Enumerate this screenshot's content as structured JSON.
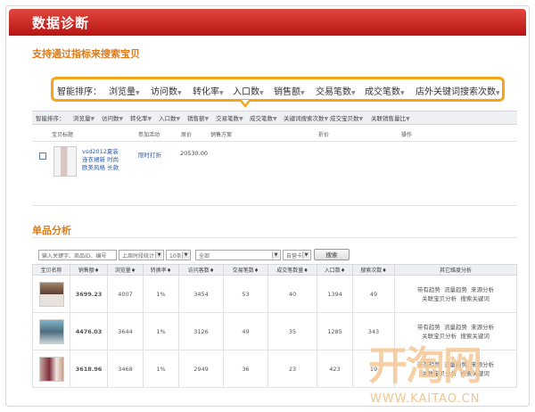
{
  "header": {
    "title": "数据诊断"
  },
  "section1": {
    "title": "支持通过指标来搜索宝贝"
  },
  "big_sort": {
    "label": "智能排序：",
    "items": [
      "浏览量",
      "访问数",
      "转化率",
      "入口数",
      "销售额",
      "交易笔数",
      "成交笔数",
      "店外关键词搜索次数"
    ]
  },
  "small_sort": {
    "label": "智能排序：",
    "items": [
      "浏览量",
      "访问数",
      "转化率",
      "入口数",
      "销售额",
      "交易笔数",
      "成交笔数",
      "关键词搜索次数",
      "成交宝贝数",
      "关联销售量比"
    ]
  },
  "columns": [
    "宝贝标题",
    "参加活动",
    "原价",
    "销售方案",
    "折价",
    "操作"
  ],
  "item": {
    "title_lines": [
      "vsd2012夏装",
      "连衣裙新 时尚",
      "欧美风格 长款"
    ],
    "activity": "限时打折",
    "price": "20530.00"
  },
  "section2": {
    "title": "单品分析"
  },
  "filters": {
    "keyword_placeholder": "输入关键字、商品ID、编号",
    "period": "上周时段统计",
    "count": "10条",
    "all": "全部",
    "type": "自营卡",
    "search": "搜索"
  },
  "table": {
    "headers": [
      "宝贝名称",
      "销售额",
      "浏览量",
      "转换率",
      "访问客数",
      "交易笔数",
      "成交笔数量",
      "入口数",
      "搜索次数",
      "其它维度分析"
    ],
    "rows": [
      {
        "sales": "3699.23",
        "views": "4007",
        "conv": "1%",
        "visitors": "3454",
        "trades": "53",
        "deals": "40",
        "entries": "1394",
        "searches": "49"
      },
      {
        "sales": "4476.03",
        "views": "3644",
        "conv": "1%",
        "visitors": "3126",
        "trades": "49",
        "deals": "35",
        "entries": "1285",
        "searches": "343"
      },
      {
        "sales": "3618.96",
        "views": "3468",
        "conv": "1%",
        "visitors": "2949",
        "trades": "36",
        "deals": "23",
        "entries": "423",
        "searches": "19"
      }
    ],
    "links": [
      "带有趋势",
      "流量趋势",
      "来源分析",
      "关联宝贝分析",
      "搜索关键词"
    ]
  },
  "watermark": {
    "logo": "开淘网",
    "url": "WWW.KAITAO.CN"
  },
  "colors": {
    "header": "#c8201a",
    "accent": "#e07a15",
    "highlight": "#f5a51b",
    "link": "#2a5aa8"
  }
}
